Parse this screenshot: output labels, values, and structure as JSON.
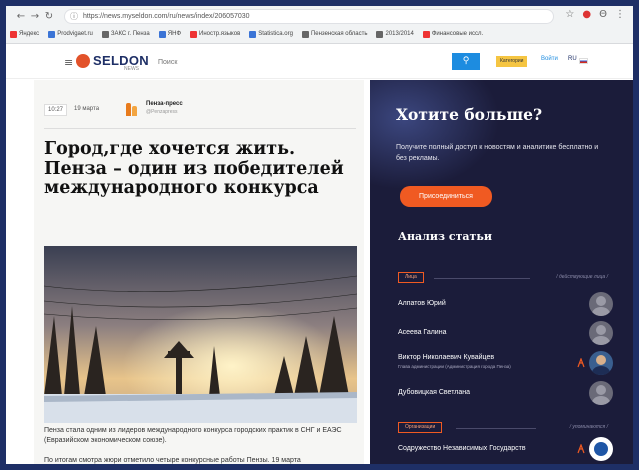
{
  "browser": {
    "url": "https://news.myseldon.com/ru/news/index/206057030",
    "bookmarks": [
      {
        "label": "Яндекс",
        "color": "#e33"
      },
      {
        "label": "Prodvigaet.ru",
        "color": "#3b74d6"
      },
      {
        "label": "ЗАКС г. Пенза",
        "color": "#666"
      },
      {
        "label": "ЯНФ",
        "color": "#3b74d6"
      },
      {
        "label": "Иностр.языков",
        "color": "#e33"
      },
      {
        "label": "Statistica.org",
        "color": "#3b74d6"
      },
      {
        "label": "Пензенская область",
        "color": "#666"
      },
      {
        "label": "2013/2014",
        "color": "#666"
      },
      {
        "label": "Финансовые иссл.",
        "color": "#e33"
      }
    ]
  },
  "header": {
    "logo_text": "SELDON",
    "logo_sub": "NEWS",
    "search_placeholder": "Поиск",
    "categories_label": "Категории",
    "login_label": "Войти",
    "lang_label": "RU"
  },
  "article": {
    "time": "10:27",
    "date": "19 марта",
    "publisher_name": "Пенза-пресс",
    "publisher_sub": "@Penzapress",
    "headline": "Город,где хочется жить. Пенза – один из победителей международного конкурса",
    "caption_before": "Пенза стала одним из лидеров международного конкурса городских практик в СНГ и ЕАЭС (Евразийском экономическом союзе).",
    "para": "По итогам смотра жюри отметило четыре конкурсные работы Пензы. 19 марта"
  },
  "sidebar": {
    "title": "Хотите больше?",
    "description": "Получите полный доступ к новостям и аналитике бесплатно и без рекламы.",
    "join_label": "Присоединиться",
    "analysis_title": "Анализ статьи",
    "persons_tag": "Лица",
    "persons_note": "/ действующие лица /",
    "persons": [
      {
        "name": "Алпатов Юрий",
        "note": ""
      },
      {
        "name": "Асеева Галина",
        "note": ""
      },
      {
        "name": "Виктор Николаевич Кувайцев",
        "note": "Глава администрации (Администрация города Пенза)"
      },
      {
        "name": "Дубовицкая Светлана",
        "note": ""
      }
    ],
    "orgs_tag": "Организации",
    "orgs_note": "/ упоминаются /",
    "orgs": [
      {
        "name": "Содружество Независимых Государств"
      }
    ]
  }
}
